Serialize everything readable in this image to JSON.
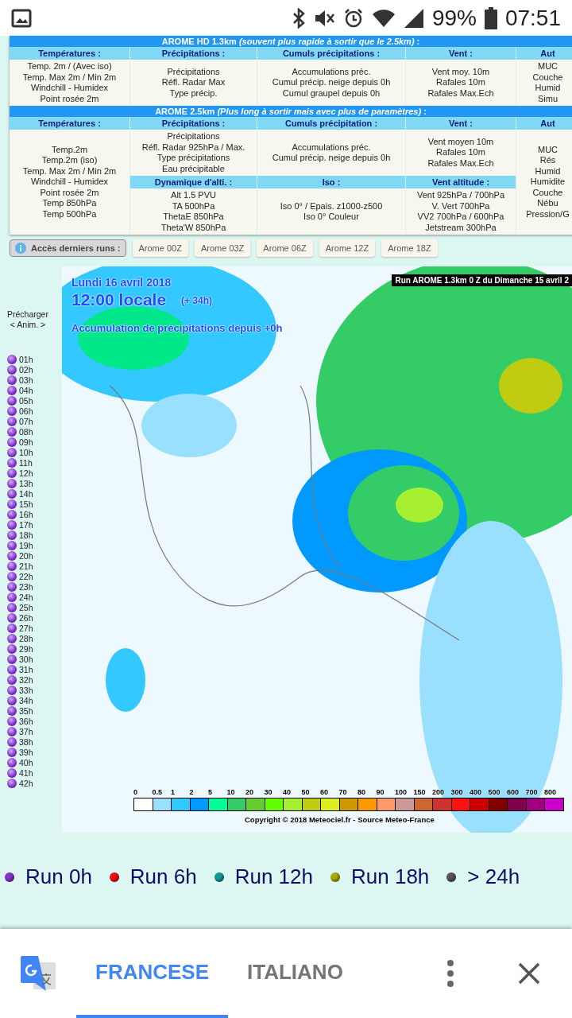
{
  "status_bar": {
    "battery": "99%",
    "time": "07:51"
  },
  "tables": [
    {
      "title": "AROME HD 1.3km *(souvent plus rapide à sortir que le 2.5km)* :",
      "headers": [
        "Températures :",
        "Précipitations :",
        "Cumuls précipitations :",
        "Vent :",
        "Aut"
      ],
      "cells": [
        [
          "Temp. 2m / (Avec iso)",
          "Temp. Max 2m / Min 2m",
          "Windchill - Humidex",
          "Point rosée 2m"
        ],
        [
          "Précipitations",
          "Réfl. Radar Max",
          "Type précip."
        ],
        [
          "Accumulations préc.",
          "Cumul précip. neige depuis 0h",
          "Cumul graupel depuis 0h"
        ],
        [
          "Vent moy. 10m",
          "Rafales 10m",
          "Rafales Max.Ech"
        ],
        [
          "MUC",
          "Couche",
          "Humid",
          "Simu"
        ]
      ]
    },
    {
      "title": "AROME 2.5km *(Plus long à sortir mais avec plus de paramètres)* :",
      "headers": [
        "Températures :",
        "Précipitations :",
        "Cumuls précipitation :",
        "Vent :",
        "Aut"
      ],
      "cells": [
        [
          "Temp.2m",
          "Temp.2m (iso)",
          "Temp. Max 2m / Min 2m",
          "Windchill - Humidex",
          "Point rosée 2m",
          "Temp 850hPa",
          "Temp 500hPa"
        ],
        [
          "Précipitations",
          "Réfl. Radar 925hPa / Max.",
          "Type précipitations",
          "Eau précipitable"
        ],
        [
          "Accumulations préc.",
          "Cumul précip. neige depuis 0h"
        ],
        [
          "Vent moyen 10m",
          "Rafales 10m",
          "Rafales Max.Ech"
        ],
        [
          "MUC",
          "Rés",
          "Humid",
          "Humidite",
          "Couche",
          "Nébu",
          "Pression/G"
        ]
      ],
      "sub_headers": [
        "Dynamique d'alti. :",
        "Iso :",
        "Vent altitude :"
      ],
      "sub_cells": [
        [
          "Alt 1.5 PVU",
          "TA 500hPa",
          "ThetaE 850hPa",
          "Theta'W 850hPa"
        ],
        [
          "Iso 0° / Epais. z1000-z500",
          "Iso 0° Couleur"
        ],
        [
          "Vent 925hPa / 700hPa",
          "V. Vert 700hPa",
          "VV2 700hPa / 600hPa",
          "Jetstream 300hPa"
        ]
      ]
    }
  ],
  "runs_access": {
    "label": "Accès derniers runs :",
    "runs": [
      "Arome 00Z",
      "Arome 03Z",
      "Arome 06Z",
      "Arome 12Z",
      "Arome 18Z"
    ]
  },
  "preload": {
    "label": "Précharger",
    "anim": "< Anim. >"
  },
  "hours": [
    "01h",
    "02h",
    "03h",
    "04h",
    "05h",
    "06h",
    "07h",
    "08h",
    "09h",
    "10h",
    "11h",
    "12h",
    "13h",
    "14h",
    "15h",
    "16h",
    "17h",
    "18h",
    "19h",
    "20h",
    "21h",
    "22h",
    "23h",
    "24h",
    "25h",
    "26h",
    "27h",
    "28h",
    "29h",
    "30h",
    "31h",
    "32h",
    "33h",
    "34h",
    "35h",
    "36h",
    "37h",
    "38h",
    "39h",
    "40h",
    "41h",
    "42h"
  ],
  "map": {
    "date": "Lundi 16 avril 2018",
    "time": "12:00 locale",
    "offset": "(+ 34h)",
    "parameter": "Accumulation de précipitations depuis +0h",
    "run_info": "Run AROME 1.3km 0 Z du Dimanche 15 avril 2",
    "scale": [
      {
        "label": "0",
        "color": "#ffffff"
      },
      {
        "label": "0.5",
        "color": "#99e0ff"
      },
      {
        "label": "1",
        "color": "#33c8ff"
      },
      {
        "label": "2",
        "color": "#0099ff"
      },
      {
        "label": "5",
        "color": "#00ff99"
      },
      {
        "label": "10",
        "color": "#33cc66"
      },
      {
        "label": "20",
        "color": "#66cc33"
      },
      {
        "label": "30",
        "color": "#66ff00"
      },
      {
        "label": "40",
        "color": "#a6ef33"
      },
      {
        "label": "50",
        "color": "#bfcc11"
      },
      {
        "label": "60",
        "color": "#dcee22"
      },
      {
        "label": "70",
        "color": "#cc9900"
      },
      {
        "label": "80",
        "color": "#ff9900"
      },
      {
        "label": "90",
        "color": "#ff9966"
      },
      {
        "label": "100",
        "color": "#cc9999"
      },
      {
        "label": "150",
        "color": "#cc6633"
      },
      {
        "label": "200",
        "color": "#cc3333"
      },
      {
        "label": "300",
        "color": "#ff1111"
      },
      {
        "label": "400",
        "color": "#cc0000"
      },
      {
        "label": "500",
        "color": "#800000"
      },
      {
        "label": "600",
        "color": "#800050"
      },
      {
        "label": "700",
        "color": "#a00080"
      },
      {
        "label": "800",
        "color": "#cc00cc"
      }
    ],
    "copyright": "Copyright © 2018 Meteociel.fr - Source Meteo-France"
  },
  "run_legend": [
    {
      "label": "Run 0h",
      "color": "#8833cc"
    },
    {
      "label": "Run 6h",
      "color": "#ee1111"
    },
    {
      "label": "Run 12h",
      "color": "#119999"
    },
    {
      "label": "Run 18h",
      "color": "#aaaa00"
    },
    {
      "label": "> 24h",
      "color": "#555555"
    }
  ],
  "translate_bar": {
    "tabs": [
      {
        "label": "FRANCESE",
        "selected": true
      },
      {
        "label": "ITALIANO",
        "selected": false
      }
    ]
  }
}
